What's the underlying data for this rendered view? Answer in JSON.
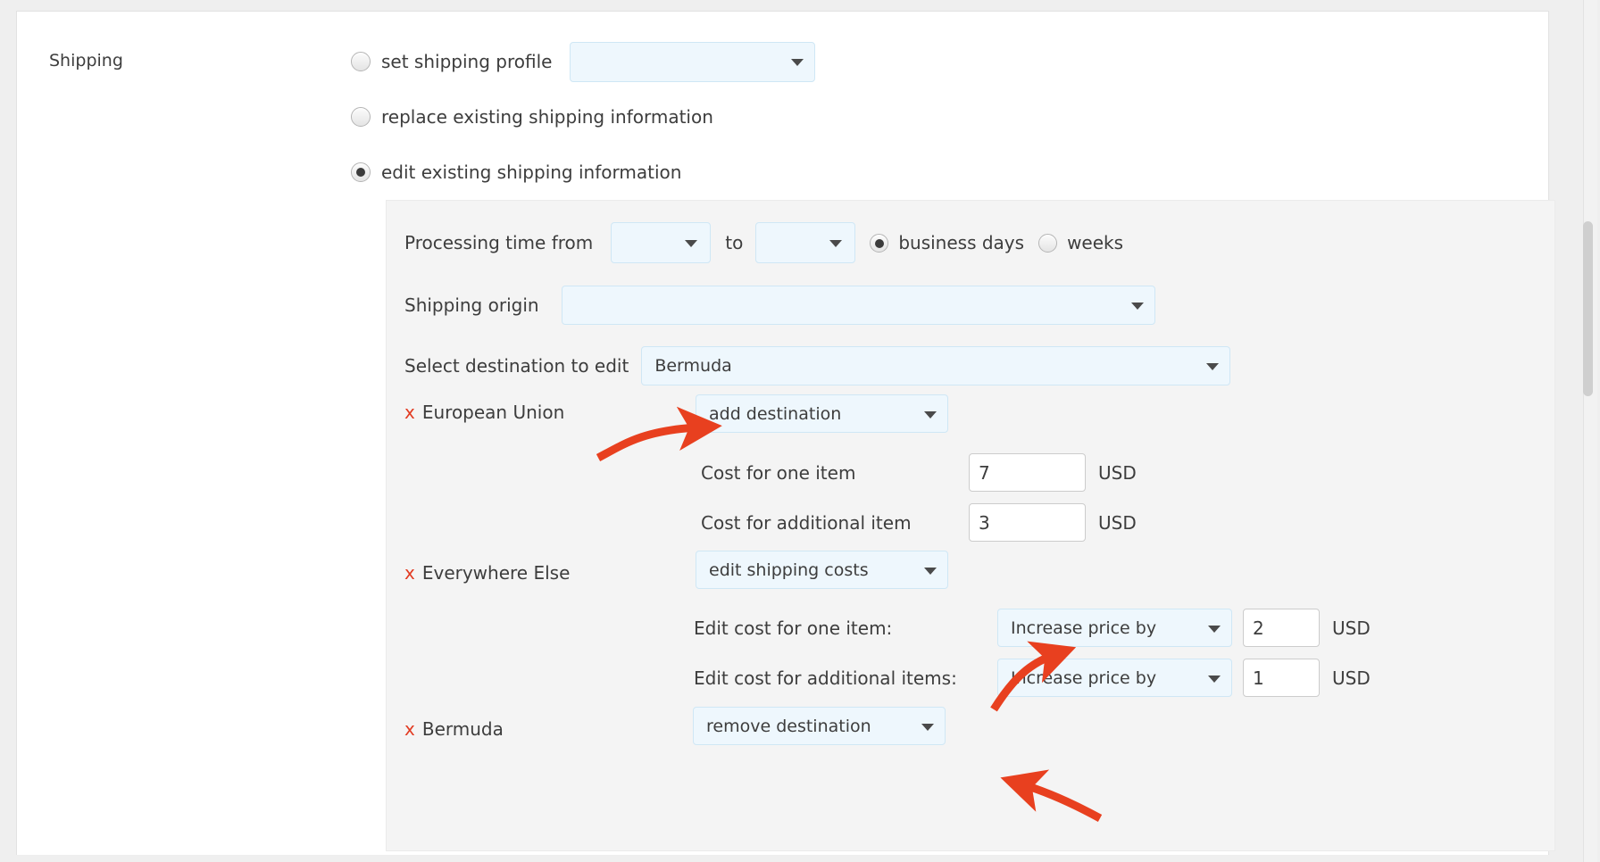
{
  "section": {
    "label": "Shipping"
  },
  "colors": {
    "accent_red": "#e23c23",
    "select_bg": "#eef7fd",
    "select_border": "#cfe7f5",
    "panel_bg": "#f4f4f4",
    "text": "#3d3d3d"
  },
  "shipping_options": [
    {
      "label": "set shipping profile",
      "selected": false,
      "has_select": true,
      "select_value": ""
    },
    {
      "label": "replace existing shipping information",
      "selected": false,
      "has_select": false
    },
    {
      "label": "edit existing shipping information",
      "selected": true,
      "has_select": false
    }
  ],
  "editor": {
    "processing_time": {
      "label": "Processing time from",
      "from_value": "",
      "to_word": "to",
      "to_value": "",
      "units": [
        {
          "label": "business days",
          "selected": true
        },
        {
          "label": "weeks",
          "selected": false
        }
      ]
    },
    "shipping_origin": {
      "label": "Shipping origin",
      "value": ""
    },
    "select_destination": {
      "label": "Select destination to edit",
      "value": "Bermuda"
    },
    "destinations": [
      {
        "delete_glyph": "x",
        "name": "European Union",
        "action": "add destination",
        "costs": [
          {
            "label": "Cost for one item",
            "value": "7",
            "currency": "USD"
          },
          {
            "label": "Cost for additional item",
            "value": "3",
            "currency": "USD"
          }
        ]
      },
      {
        "delete_glyph": "x",
        "name": "Everywhere Else",
        "action": "edit shipping costs",
        "edits": [
          {
            "label": "Edit cost for one item:",
            "mode": "Increase price by",
            "value": "2",
            "currency": "USD"
          },
          {
            "label": "Edit cost for additional items:",
            "mode": "Increase price by",
            "value": "1",
            "currency": "USD"
          }
        ]
      },
      {
        "delete_glyph": "x",
        "name": "Bermuda",
        "action": "remove destination"
      }
    ]
  },
  "annotations": [
    {
      "name": "arrow-to-add-destination"
    },
    {
      "name": "arrow-to-increase-price-by"
    },
    {
      "name": "arrow-to-remove-destination"
    }
  ]
}
